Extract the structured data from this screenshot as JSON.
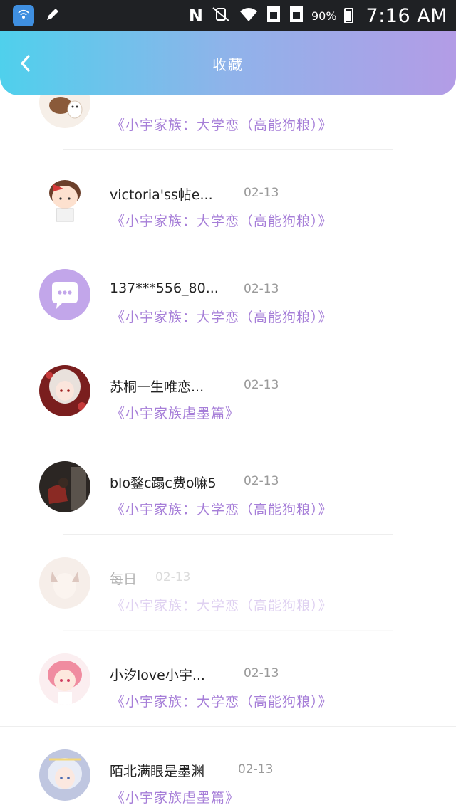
{
  "status_bar": {
    "icons": [
      "wifi-hotspot-icon",
      "pencil-icon",
      "nfc-icon",
      "vibrate-mute-icon",
      "wifi-icon",
      "sim1-icon",
      "sim2-icon",
      "battery-icon"
    ],
    "battery": "90%",
    "time": "7:16 AM"
  },
  "header": {
    "title": "收藏",
    "back_icon": "chevron-left-icon"
  },
  "items": [
    {
      "name": "",
      "date": "",
      "subject": "《小宇家族：大学恋（高能狗粮）》"
    },
    {
      "name": "victoria'ss帖e...",
      "date": "02-13",
      "subject": "《小宇家族：大学恋（高能狗粮）》"
    },
    {
      "name": "137***556_80...",
      "date": "02-13",
      "subject": "《小宇家族：大学恋（高能狗粮）》"
    },
    {
      "name": "苏桐一生唯恋...",
      "date": "02-13",
      "subject": "《小宇家族虐墨篇》"
    },
    {
      "name": "blo鍪c蹋c费o嘛5",
      "date": "02-13",
      "subject": "《小宇家族：大学恋（高能狗粮）》"
    },
    {
      "name": "每日",
      "date": "02-13",
      "subject": "《小宇家族：大学恋（高能狗粮）》"
    },
    {
      "name": "小汐love小宇...",
      "date": "02-13",
      "subject": "《小宇家族：大学恋（高能狗粮）》"
    },
    {
      "name": "陌北满眼是墨渊",
      "date": "02-13",
      "subject": "《小宇家族虐墨篇》"
    }
  ],
  "colors": {
    "accent_purple": "#a67ed8",
    "header_start": "#4fd0ec",
    "header_end": "#b39ce6"
  }
}
